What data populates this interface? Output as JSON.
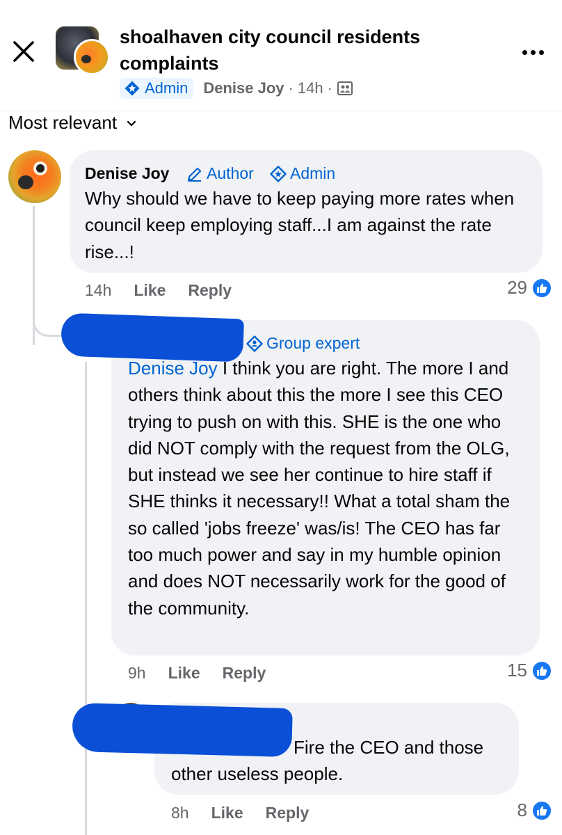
{
  "header": {
    "group_name": "shoalhaven city council  residents complaints",
    "admin_label": "Admin",
    "author": "Denise Joy",
    "time": "14h",
    "dot": "·"
  },
  "sort": {
    "label": "Most relevant"
  },
  "comments": [
    {
      "author": "Denise Joy",
      "badges": [
        "Author",
        "Admin"
      ],
      "text": "Why should we have to keep paying more rates when council keep employing staff...I am against the rate rise...!",
      "time": "14h",
      "like_label": "Like",
      "reply_label": "Reply",
      "reactions": "29"
    },
    {
      "badge": "Group expert",
      "mention": "Denise Joy",
      "text": " I think you are right. The more I and others think about this the more I see this CEO trying to push on with this. SHE is the one who did NOT comply with the request from the OLG, but instead we see her continue to hire staff if SHE thinks it necessary!! What a total sham the so called 'jobs freeze' was/is! The CEO has far too much power and say in my humble opinion and does NOT necessarily work for the good of the community.",
      "time": "9h",
      "like_label": "Like",
      "reply_label": "Reply",
      "reactions": "15"
    },
    {
      "text_line1": "Fire the CEO and those",
      "text_line2": "other useless people.",
      "time": "8h",
      "like_label": "Like",
      "reply_label": "Reply",
      "reactions": "8"
    }
  ],
  "colors": {
    "accent": "#0064d1",
    "like_blue": "#1877f2",
    "bubble": "#f0f2f5",
    "redaction": "#0a4fd6"
  },
  "icons": [
    "close-icon",
    "more-icon",
    "admin-icon",
    "audience-icon",
    "chevron-down-icon",
    "pencil-icon",
    "like-reaction-icon",
    "group-expert-icon"
  ]
}
